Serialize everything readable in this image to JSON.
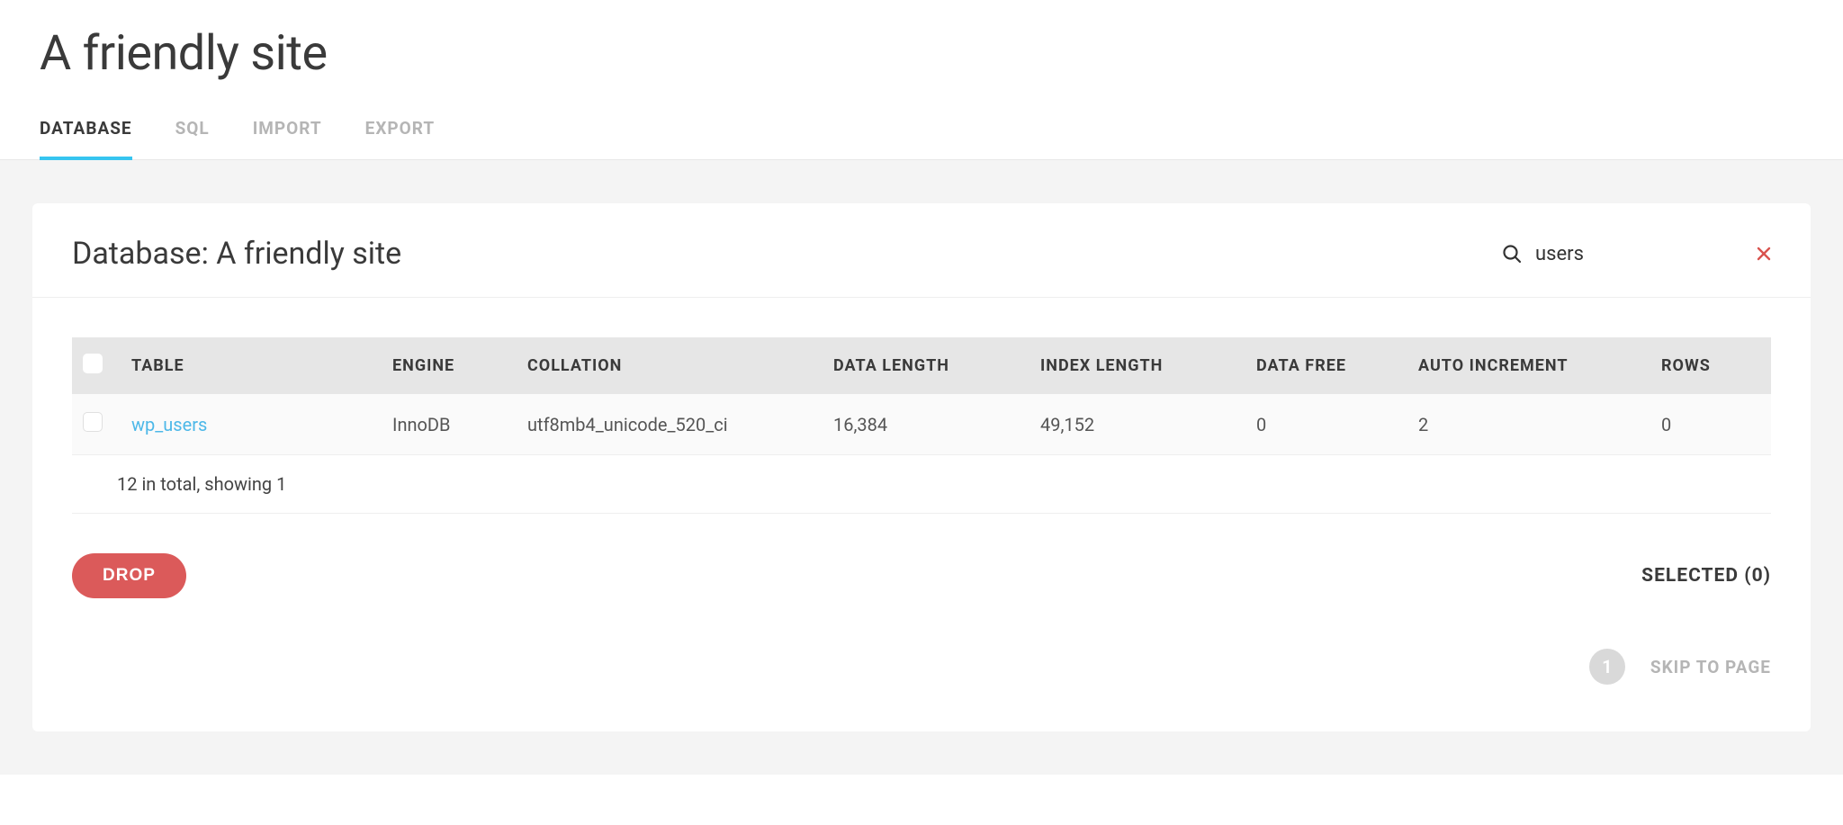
{
  "site_title": "A friendly site",
  "tabs": {
    "database": "DATABASE",
    "sql": "SQL",
    "import": "IMPORT",
    "export": "EXPORT"
  },
  "panel": {
    "title": "Database: A friendly site",
    "search_value": "users"
  },
  "table": {
    "headers": {
      "table": "TABLE",
      "engine": "ENGINE",
      "collation": "COLLATION",
      "data_length": "DATA LENGTH",
      "index_length": "INDEX LENGTH",
      "data_free": "DATA FREE",
      "auto_increment": "AUTO INCREMENT",
      "rows": "ROWS"
    },
    "rows": [
      {
        "table": "wp_users",
        "engine": "InnoDB",
        "collation": "utf8mb4_unicode_520_ci",
        "data_length": "16,384",
        "index_length": "49,152",
        "data_free": "0",
        "auto_increment": "2",
        "rows": "0"
      }
    ],
    "summary": "12 in total, showing 1"
  },
  "actions": {
    "drop": "DROP",
    "selected": "SELECTED (0)"
  },
  "pager": {
    "current": "1",
    "skip": "SKIP TO PAGE"
  }
}
